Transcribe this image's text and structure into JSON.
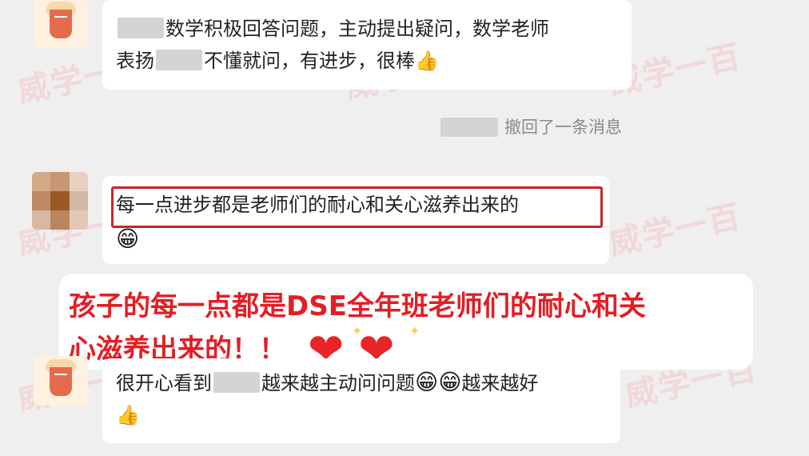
{
  "watermark": "威学一百",
  "messages": [
    {
      "text_line1_after": "数学积极回答问题，主动提出疑问，数学老师",
      "text_line2_before": "表扬",
      "text_line2_after": "不懂就问，有进步，很棒",
      "emoji": "👍"
    },
    {
      "system_text": "撤回了一条消息"
    },
    {
      "text": "每一点进步都是老师们的耐心和关心滋养出来的",
      "emoji": "😁"
    },
    {
      "caption_line1": "孩子的每一点都是DSE全年班老师们的耐心和关",
      "caption_line2": "心滋养出来的！！",
      "hearts": [
        "❤",
        "❤"
      ]
    },
    {
      "text_before": "很开心看到",
      "text_middle": "越来越主动问问题",
      "emoji_1": "😁",
      "emoji_2": "😁",
      "text_after": "越来越好",
      "emoji_3": "👍"
    }
  ]
}
